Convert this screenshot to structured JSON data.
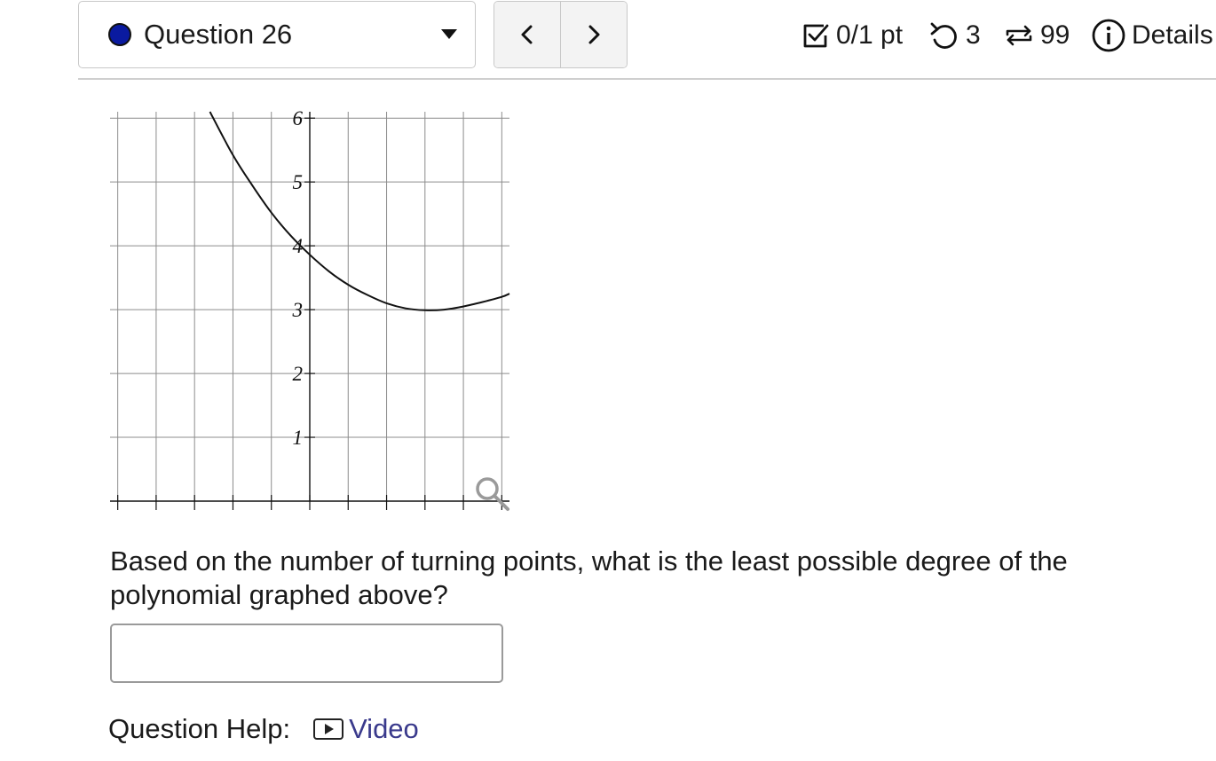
{
  "header": {
    "question_label": "Question 26",
    "status_dot_color": "#0a1aa0",
    "prev_icon": "chevron-left-icon",
    "next_icon": "chevron-right-icon",
    "score": "0/1 pt",
    "retries": "3",
    "attempts": "99",
    "details_label": "Details"
  },
  "chart_data": {
    "type": "line",
    "title": "",
    "xlabel": "",
    "ylabel": "",
    "xlim": [
      -5.2,
      5.2
    ],
    "ylim": [
      0,
      6.1
    ],
    "x_gridlines": [
      -5,
      -4,
      -3,
      -2,
      -1,
      0,
      1,
      2,
      3,
      4,
      5
    ],
    "y_ticks": [
      1,
      2,
      3,
      4,
      5,
      6
    ],
    "y_tick_labels": [
      "1",
      "2",
      "3",
      "4",
      "5",
      "6"
    ],
    "grid": true,
    "series": [
      {
        "x": [
          -2.6,
          -2.0,
          -1.5,
          -1.0,
          -0.5,
          0.0,
          0.5,
          1.0,
          1.5,
          2.0,
          2.5,
          3.0,
          3.5,
          4.0,
          4.5,
          5.0,
          5.2
        ],
        "y": [
          6.1,
          5.42,
          4.95,
          4.52,
          4.16,
          3.86,
          3.6,
          3.39,
          3.23,
          3.1,
          3.02,
          2.99,
          3.0,
          3.05,
          3.12,
          3.2,
          3.25
        ]
      }
    ]
  },
  "question": {
    "text": "Based on the number of turning points, what is the least possible degree of the polynomial graphed above?"
  },
  "answer": {
    "value": ""
  },
  "help": {
    "label": "Question Help:",
    "video_label": "Video",
    "video_icon": "video-icon"
  }
}
